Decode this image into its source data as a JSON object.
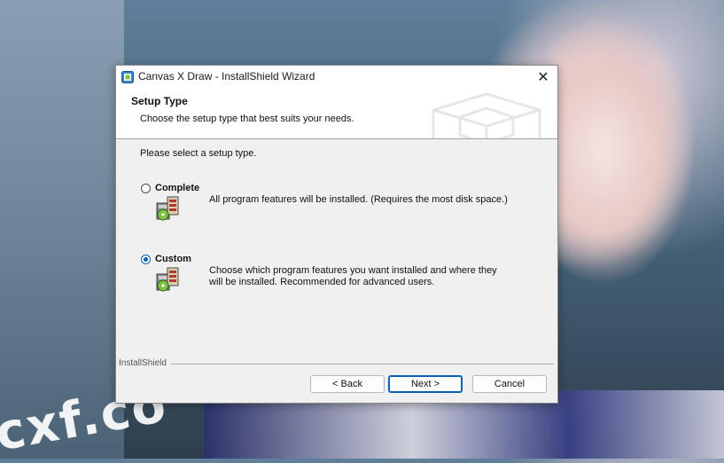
{
  "window": {
    "title": "Canvas X Draw - InstallShield Wizard",
    "close_glyph": "✕"
  },
  "header": {
    "title": "Setup Type",
    "subtitle": "Choose the setup type that best suits your needs."
  },
  "prompt": "Please select a setup type.",
  "options": [
    {
      "label": "Complete",
      "description": "All program features will be installed. (Requires the most disk space.)",
      "selected": false,
      "icon": "package-complete-icon"
    },
    {
      "label": "Custom",
      "description": "Choose which program features you want installed and where they will be installed. Recommended for advanced users.",
      "selected": true,
      "icon": "package-custom-icon"
    }
  ],
  "footer": {
    "brand": "InstallShield",
    "back_label": "< Back",
    "next_label": "Next >",
    "cancel_label": "Cancel"
  },
  "desktop": {
    "watermark": "cxf.co"
  },
  "colors": {
    "accent": "#0a5fb4",
    "dialog_bg": "#f0f0f0"
  }
}
